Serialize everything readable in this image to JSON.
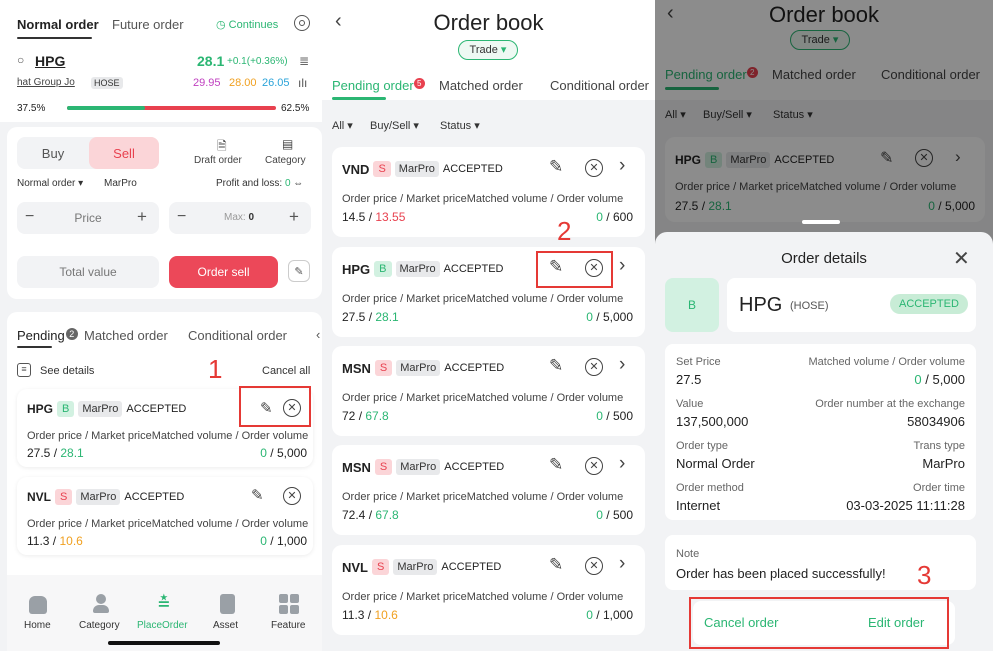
{
  "p1": {
    "tabs": [
      "Normal order",
      "Future order"
    ],
    "continues": "Continues",
    "symbol": "HPG",
    "price": "28.1",
    "change": "+0.1(+0.36%)",
    "company": "hat Group Jo",
    "exchange": "HOSE",
    "ceil": "29.95",
    "ref": "28.00",
    "floor": "26.05",
    "buy_pct": "37.5%",
    "sell_pct": "62.5%",
    "buy_ratio": 0.375,
    "buy_label": "Buy",
    "sell_label": "Sell",
    "draft_order": "Draft order",
    "category": "Category",
    "order_type": "Normal order",
    "account": "MarPro",
    "pnl_label": "Profit and loss:",
    "pnl_value": "0",
    "price_placeholder": "Price",
    "max_label": "Max:",
    "max_value": "0",
    "total_value": "Total value",
    "order_sell": "Order sell",
    "tabs2": [
      "Pending",
      "Matched order",
      "Conditional order"
    ],
    "pending_badge": "2",
    "see_details": "See details",
    "cancel_all": "Cancel all",
    "orders": [
      {
        "sym": "HPG",
        "side": "B",
        "acct": "MarPro",
        "status": "ACCEPTED",
        "hdr": "Order price / Market price",
        "hdr2": "Matched volume / Order volume",
        "p": "27.5",
        "mp": "28.1",
        "mv": "0",
        "ov": "5,000"
      },
      {
        "sym": "NVL",
        "side": "S",
        "acct": "MarPro",
        "status": "ACCEPTED",
        "hdr": "Order price / Market price",
        "hdr2": "Matched volume / Order volume",
        "p": "11.3",
        "mp": "10.6",
        "mv": "0",
        "ov": "1,000"
      }
    ],
    "nav": [
      "Home",
      "Category",
      "PlaceOrder",
      "Asset",
      "Feature"
    ],
    "marker": "1"
  },
  "p2": {
    "title": "Order book",
    "trade": "Trade",
    "tabs": [
      "Pending order",
      "Matched order",
      "Conditional order"
    ],
    "badge": "5",
    "filters": [
      "All",
      "Buy/Sell",
      "Status"
    ],
    "orders": [
      {
        "sym": "VND",
        "side": "S",
        "acct": "MarPro",
        "status": "ACCEPTED",
        "p": "14.5",
        "mp": "13.55",
        "mv": "0",
        "ov": "600"
      },
      {
        "sym": "HPG",
        "side": "B",
        "acct": "MarPro",
        "status": "ACCEPTED",
        "p": "27.5",
        "mp": "28.1",
        "mv": "0",
        "ov": "5,000"
      },
      {
        "sym": "MSN",
        "side": "S",
        "acct": "MarPro",
        "status": "ACCEPTED",
        "p": "72",
        "mp": "67.8",
        "mv": "0",
        "ov": "500"
      },
      {
        "sym": "MSN",
        "side": "S",
        "acct": "MarPro",
        "status": "ACCEPTED",
        "p": "72.4",
        "mp": "67.8",
        "mv": "0",
        "ov": "500"
      },
      {
        "sym": "NVL",
        "side": "S",
        "acct": "MarPro",
        "status": "ACCEPTED",
        "p": "11.3",
        "mp": "10.6",
        "mv": "0",
        "ov": "1,000"
      }
    ],
    "hdr": "Order price / Market price",
    "hdr2": "Matched volume / Order volume",
    "marker": "2"
  },
  "p3": {
    "title": "Order book",
    "trade": "Trade",
    "tabs": [
      "Pending order",
      "Matched order",
      "Conditional order"
    ],
    "badge": "2",
    "filters": [
      "All",
      "Buy/Sell",
      "Status"
    ],
    "bg_order": {
      "sym": "HPG",
      "side": "B",
      "acct": "MarPro",
      "status": "ACCEPTED",
      "hdr": "Order price / Market price",
      "hdr2": "Matched volume / Order volume",
      "p": "27.5",
      "mp": "28.1",
      "mv": "0",
      "ov": "5,000"
    },
    "sheet_title": "Order details",
    "side": "B",
    "sym": "HPG",
    "exch": "(HOSE)",
    "status": "ACCEPTED",
    "fields": [
      {
        "l": "Set Price",
        "v": "27.5",
        "rl": "Matched volume / Order volume",
        "rv_a": "0",
        "rv_b": " / 5,000"
      },
      {
        "l": "Value",
        "v": "137,500,000",
        "rl": "Order number at the exchange",
        "rv_a": "",
        "rv_b": "58034906"
      },
      {
        "l": "Order type",
        "v": "Normal Order",
        "rl": "Trans type",
        "rv_a": "",
        "rv_b": "MarPro"
      },
      {
        "l": "Order method",
        "v": "Internet",
        "rl": "Order time",
        "rv_a": "",
        "rv_b": "03-03-2025 11:11:28"
      }
    ],
    "note_label": "Note",
    "note": "Order has been placed successfully!",
    "cancel_order": "Cancel order",
    "edit_order": "Edit order",
    "marker": "3"
  }
}
